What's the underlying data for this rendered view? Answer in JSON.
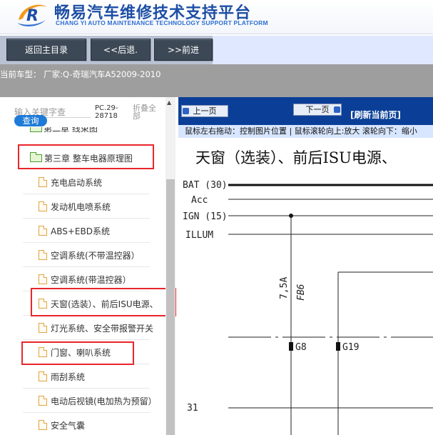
{
  "header": {
    "title": "畅易汽车维修技术支持平台",
    "subtitle": "CHANG YI AUTO MAINTENANCE TECHNOLOGY SUPPORT PLATFORM",
    "logo_letter": "R"
  },
  "toolbar": {
    "main_menu": "返回主目录",
    "back": "<<后退.",
    "forward": ">>前进"
  },
  "vehicle": {
    "label": "当前车型：  厂家:Q-奇瑞汽车A52009-2010"
  },
  "sidebar": {
    "search_placeholder": "输入关键字查",
    "query_button": "查询",
    "pc_code": "PC.29-28718",
    "collapse_all": "折叠全部",
    "partial_item": "第二章 线束图",
    "chapter": "第三章 整车电器原理图",
    "items": [
      {
        "label": "充电启动系统"
      },
      {
        "label": "发动机电喷系统"
      },
      {
        "label": "ABS+EBD系统"
      },
      {
        "label": "空调系统(不带温控器）"
      },
      {
        "label": "空调系统(带温控器）"
      },
      {
        "label": "天窗(选装）、前后ISU电源、"
      },
      {
        "label": "灯光系统、安全带报警开关"
      },
      {
        "label": "门窗、喇叭系统"
      },
      {
        "label": "雨刮系统"
      },
      {
        "label": "电动后视镜(电加热为预留）"
      },
      {
        "label": "安全气囊"
      }
    ]
  },
  "viewer": {
    "prev_page": "上一页",
    "next_page": "下一页",
    "refresh": "[刷新当前页]",
    "hint": "鼠标左右拖动：控制图片位置  |  鼠标滚轮向上:放大   滚轮向下：缩小",
    "diagram_title": "天窗（选装）、前后ISU电源、",
    "signals": [
      "BAT (30)",
      "Acc",
      "IGN (15)",
      "ILLUM"
    ],
    "wire_labels": [
      "7,5A",
      "FB6"
    ],
    "connectors": [
      "G8",
      "G19"
    ],
    "row_number": "31"
  },
  "colors": {
    "brand_blue": "#1d4ea5",
    "toolbar_button": "#3d4856",
    "pager_blue": "#0b3f97",
    "highlight_red": "#e8262b",
    "query_blue": "#1e7bd8"
  }
}
